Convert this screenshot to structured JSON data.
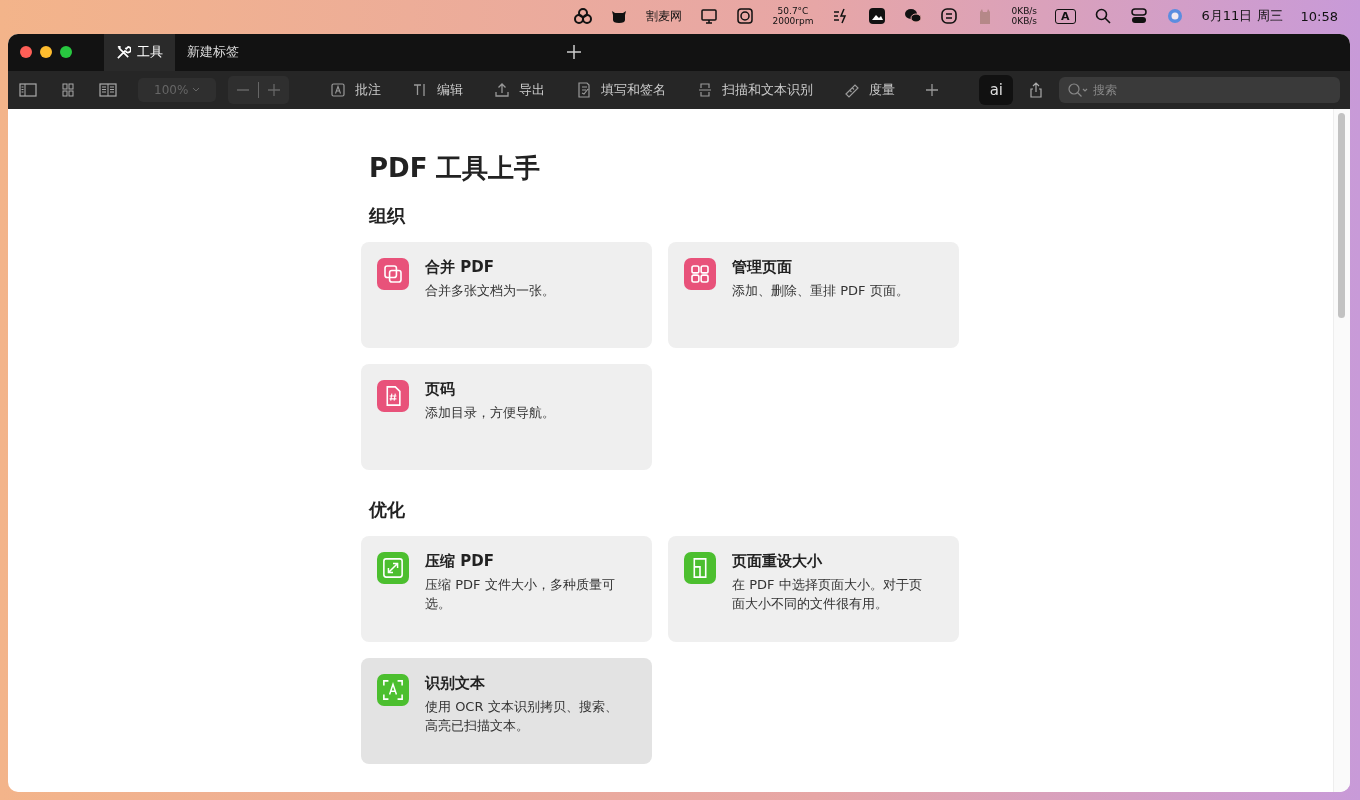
{
  "menu_bar": {
    "app_label": "割麦网",
    "fan": [
      "50.7°C",
      "2000rpm"
    ],
    "network": [
      "0KB/s",
      "0KB/s"
    ],
    "input_method": "A",
    "date": "6月11日 周三",
    "time": "10:58"
  },
  "tabs": [
    {
      "label": "工具",
      "selected": true
    },
    {
      "label": "新建标签",
      "selected": false
    }
  ],
  "toolbar": {
    "zoom": "100%",
    "zoom_disabled": true,
    "tools": [
      "批注",
      "编辑",
      "导出",
      "填写和签名",
      "扫描和文本识别",
      "度量"
    ],
    "ai_label": "ai",
    "search": {
      "placeholder": "搜索"
    }
  },
  "page": {
    "title": "PDF 工具上手",
    "sections": [
      {
        "title": "组织",
        "cards": [
          {
            "title": "合并 PDF",
            "description": "合并多张文档为一张。",
            "color": "#e8527a",
            "highlighted": false
          },
          {
            "title": "管理页面",
            "description": "添加、删除、重排 PDF 页面。",
            "color": "#e8527a",
            "highlighted": false
          },
          {
            "title": "页码",
            "description": "添加目录，方便导航。",
            "color": "#e8527a",
            "highlighted": false
          }
        ]
      },
      {
        "title": "优化",
        "cards": [
          {
            "title": "压缩 PDF",
            "description": "压缩 PDF 文件大小，多种质量可选。",
            "color": "#4cbf2f",
            "highlighted": false
          },
          {
            "title": "页面重设大小",
            "description": "在 PDF 中选择页面大小。对于页面大小不同的文件很有用。",
            "color": "#4cbf2f",
            "highlighted": false
          },
          {
            "title": "识别文本",
            "description": "使用 OCR 文本识别拷贝、搜索、高亮已扫描文本。",
            "color": "#4cbf2f",
            "highlighted": true
          }
        ]
      }
    ]
  }
}
